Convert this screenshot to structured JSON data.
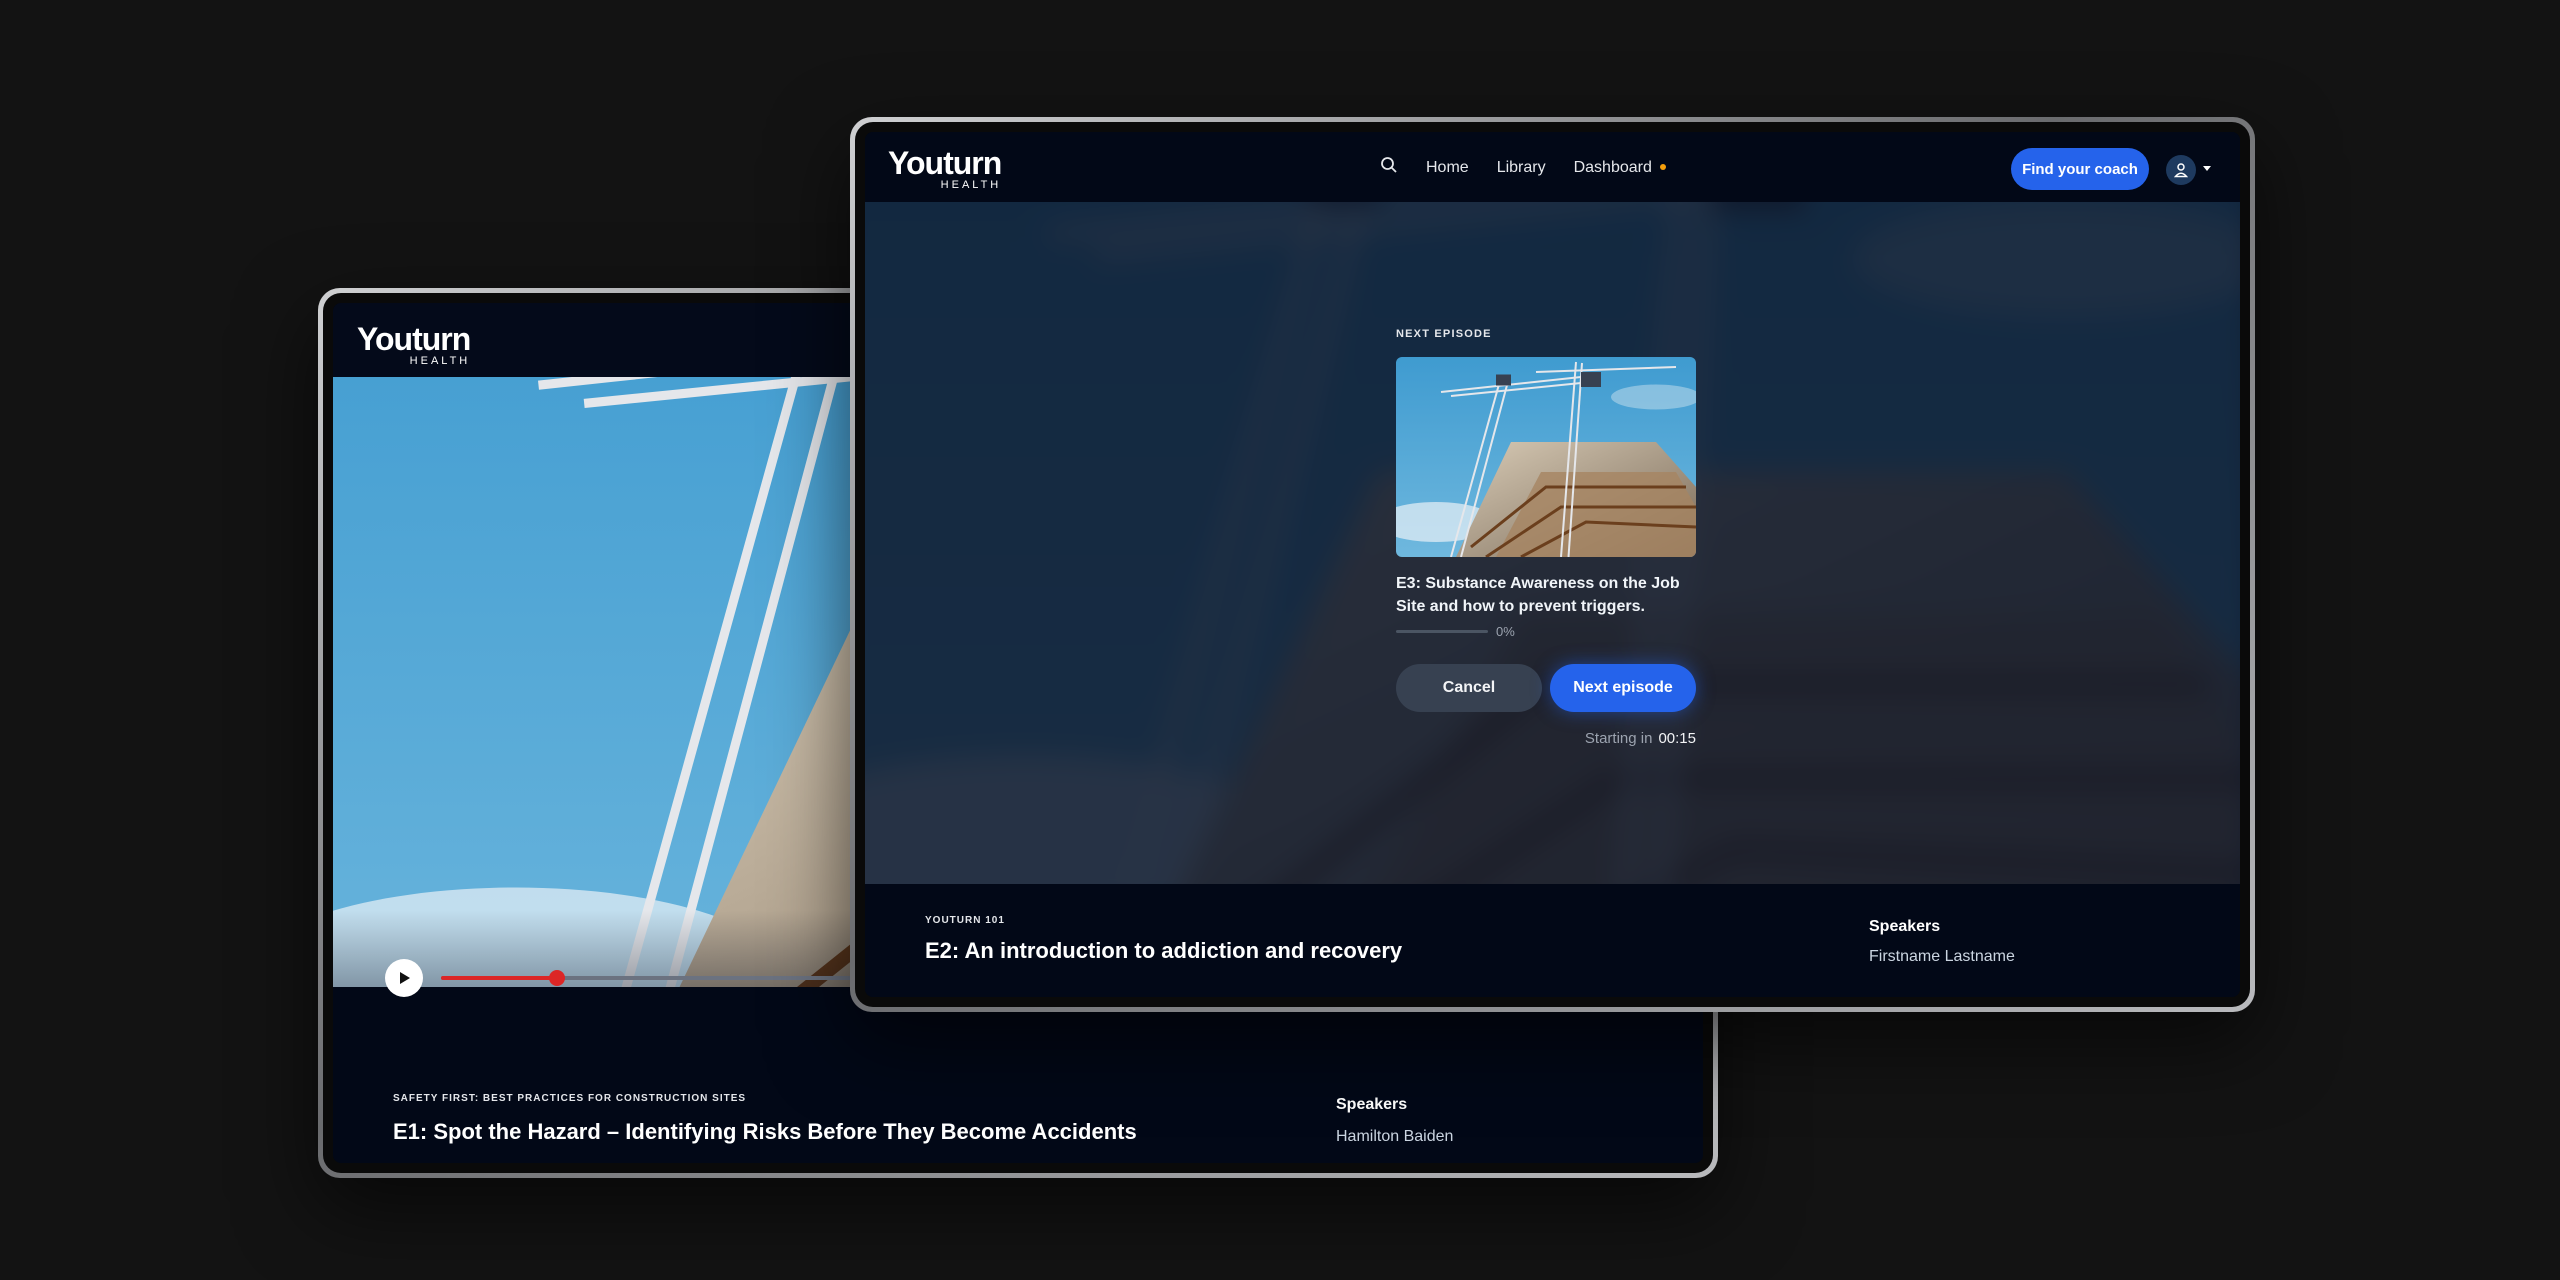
{
  "back_screen": {
    "logo": {
      "word": "Youturn",
      "sub": "HEALTH"
    },
    "player": {
      "progress_fraction": 0.115
    },
    "series": "SAFETY FIRST: BEST PRACTICES FOR CONSTRUCTION SITES",
    "episode": "E1: Spot the Hazard – Identifying Risks Before They Become Accidents",
    "speakers_heading": "Speakers",
    "speaker_name": "Hamilton Baiden"
  },
  "front_screen": {
    "logo": {
      "word": "Youturn",
      "sub": "HEALTH"
    },
    "nav": {
      "search_icon": "search-icon",
      "items": [
        "Home",
        "Library",
        "Dashboard"
      ],
      "coach_button": "Find your coach",
      "accent_dot_color": "#f59e0b"
    },
    "next_episode": {
      "label": "NEXT EPISODE",
      "title": "E3:  Substance Awareness on the Job Site and how to prevent triggers.",
      "progress_text": "0%",
      "progress_fraction": 0,
      "cancel_label": "Cancel",
      "next_label": "Next episode",
      "starting_in_label": "Starting in",
      "countdown": "00:15"
    },
    "series": "YOUTURN 101",
    "episode": "E2: An introduction to addiction and recovery",
    "speakers_heading": "Speakers",
    "speaker_name": "Firstname Lastname"
  },
  "colors": {
    "primary_button": "#2563eb",
    "scrubber": "#dc2626",
    "background": "#131313",
    "screen": "#020817"
  }
}
